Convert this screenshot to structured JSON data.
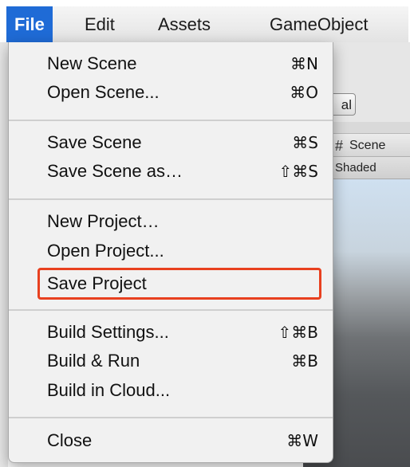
{
  "menubar": {
    "items": [
      {
        "label": "File",
        "active": true
      },
      {
        "label": "Edit"
      },
      {
        "label": "Assets"
      },
      {
        "label": "GameObject"
      }
    ]
  },
  "background": {
    "button_label": "al",
    "scene_tab_icon": "#",
    "scene_tab_label": "Scene",
    "shading_label": "Shaded"
  },
  "file_menu": {
    "items": [
      {
        "label": "New Scene",
        "shortcut": "⌘N"
      },
      {
        "label": "Open Scene...",
        "shortcut": "⌘O"
      },
      {
        "label": "Save Scene",
        "shortcut": "⌘S"
      },
      {
        "label": "Save Scene as…",
        "shortcut": "⇧⌘S"
      },
      {
        "label": "New Project…",
        "shortcut": ""
      },
      {
        "label": "Open Project...",
        "shortcut": ""
      },
      {
        "label": "Save Project",
        "shortcut": "",
        "highlighted": true
      },
      {
        "label": "Build Settings...",
        "shortcut": "⇧⌘B"
      },
      {
        "label": "Build & Run",
        "shortcut": "⌘B"
      },
      {
        "label": "Build in Cloud...",
        "shortcut": ""
      },
      {
        "label": "Close",
        "shortcut": "⌘W"
      }
    ]
  },
  "colors": {
    "menu_active": "#1f6bd6",
    "highlight_outline": "#e8401f"
  }
}
